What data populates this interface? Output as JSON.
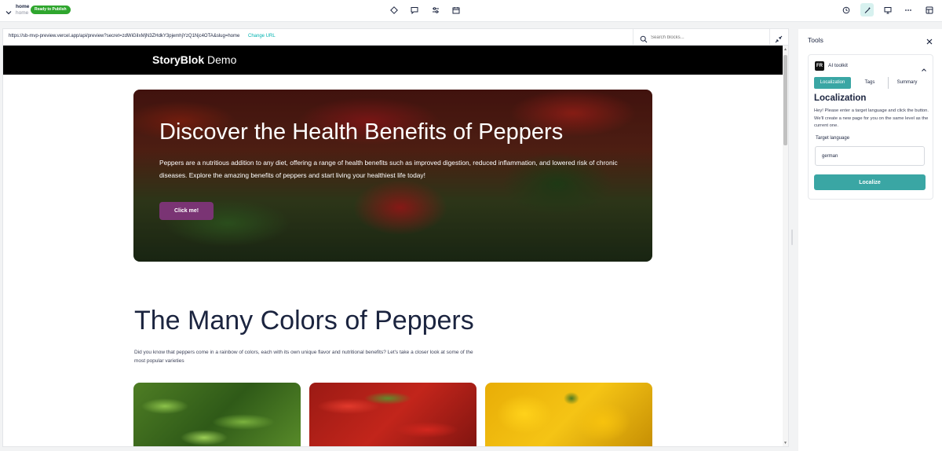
{
  "topbar": {
    "page_title": "home",
    "page_slug": "home",
    "status": "Ready to Publish",
    "status_color": "#2fa62e",
    "center_icons": [
      "diamond-icon",
      "comment-icon",
      "sliders-icon",
      "calendar-icon"
    ],
    "right_icons": [
      "history-icon",
      "wand-icon",
      "monitor-icon",
      "more-icon",
      "layout-icon"
    ]
  },
  "preview": {
    "url": "https://sb-mvp-preview.vercel.app/api/preview?secret=zdWiGiIxMjN3ZHdkY3pjemhjYzQ1Njc4OTA&slug=home",
    "change_url": "Change URL",
    "search_placeholder": "Search blocks...",
    "site": {
      "brand_bold": "StoryBlok",
      "brand_rest": " Demo",
      "hero": {
        "title": "Discover the Health Benefits of Peppers",
        "text": "Peppers are a nutritious addition to any diet, offering a range of health benefits such as improved digestion, reduced inflammation, and lowered risk of chronic diseases. Explore the amazing benefits of peppers and start living your healthiest life today!",
        "button": "Click me!"
      },
      "section": {
        "title": "The Many Colors of Peppers",
        "text": "Did you know that peppers come in a rainbow of colors, each with its own unique flavor and nutritional benefits? Let's take a closer look at some of the most popular varieties"
      },
      "cards": [
        {
          "name": "green-peppers-image"
        },
        {
          "name": "red-peppers-image"
        },
        {
          "name": "yellow-peppers-image"
        }
      ]
    }
  },
  "tools": {
    "title": "Tools",
    "ai_toolkit": {
      "logo": "FR",
      "title": "AI toolkit",
      "tabs": [
        "Localization",
        "Tags",
        "Summary"
      ],
      "active_tab": "Localization",
      "heading": "Localization",
      "description": "Hey! Please enter a target language and click the button. We'll create a new page for you on the same level as the current one.",
      "target_label": "Target language",
      "target_value": "german",
      "button": "Localize",
      "accent": "#3aa6a4"
    }
  }
}
